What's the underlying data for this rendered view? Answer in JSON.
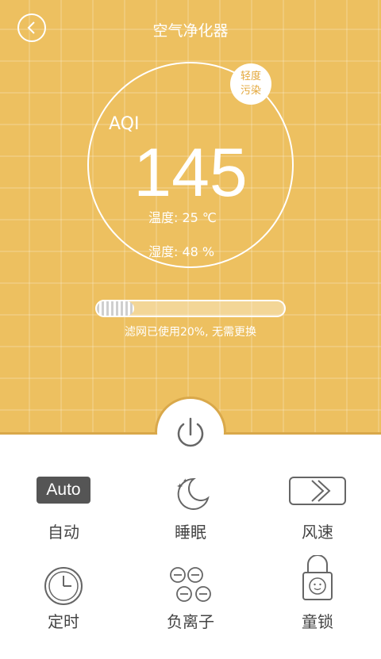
{
  "header": {
    "title": "空气净化器"
  },
  "status": {
    "badge": [
      "轻度",
      "污染"
    ],
    "aqi_label": "AQI",
    "aqi_value": "145",
    "temperature": "温度:  25 ℃",
    "humidity": "湿度:  48 %"
  },
  "filter": {
    "used_percent": 0.2,
    "text": "滤网已使用20%, 无需更换"
  },
  "controls": [
    {
      "label": "自动",
      "icon": "auto-badge",
      "badge_text": "Auto"
    },
    {
      "label": "睡眠",
      "icon": "moon-icon"
    },
    {
      "label": "风速",
      "icon": "wind-speed-icon"
    },
    {
      "label": "定时",
      "icon": "clock-icon"
    },
    {
      "label": "负离子",
      "icon": "ion-icon"
    },
    {
      "label": "童锁",
      "icon": "child-lock-icon"
    }
  ],
  "colors": {
    "accent": "#edc060",
    "accent_dark": "#d9a84a",
    "badge_text": "#e3a73a"
  }
}
